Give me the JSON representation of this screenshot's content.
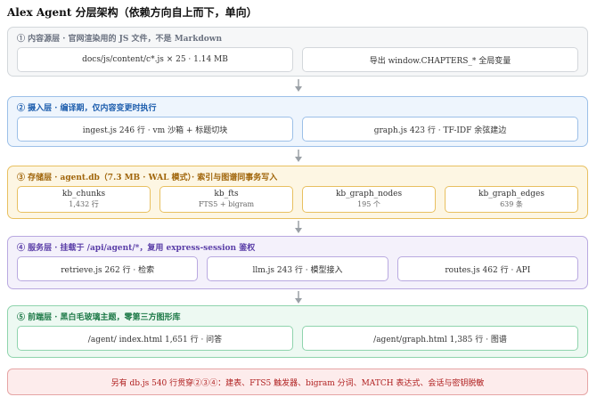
{
  "title": "Alex Agent 分层架构（依赖方向自上而下，单向）",
  "colors": {
    "layer1": {
      "bg": "#f6f7f8",
      "border": "#d3d7db",
      "text": "#6b7280"
    },
    "layer2": {
      "bg": "#eef5fd",
      "border": "#9cc0e8",
      "text": "#1f5fae"
    },
    "layer3": {
      "bg": "#fdf6e3",
      "border": "#e8c060",
      "text": "#a0650a"
    },
    "layer4": {
      "bg": "#f4f1fb",
      "border": "#b9a9e0",
      "text": "#5b3fa8"
    },
    "layer5": {
      "bg": "#edf9f2",
      "border": "#8fd4ad",
      "text": "#1e7a48"
    },
    "note": {
      "bg": "#fdecec",
      "border": "#e6a5a5",
      "text": "#b02020"
    },
    "arrow": "#9aa0a6"
  },
  "layers": [
    {
      "title": "① 内容源层 · 官网渲染用的 JS 文件，不是 Markdown",
      "cells": [
        {
          "text": "docs/js/content/c*.js × 25 · 1.14 MB"
        },
        {
          "text": "导出 window.CHAPTERS_* 全局变量"
        }
      ]
    },
    {
      "title": "② 摄入层 · 编译期，仅内容变更时执行",
      "cells": [
        {
          "text": "ingest.js 246 行 · vm 沙箱 + 标题切块"
        },
        {
          "text": "graph.js 423 行 · TF-IDF 余弦建边"
        }
      ]
    },
    {
      "title": "③ 存储层 · agent.db（7.3 MB · WAL 模式）· 索引与图谱同事务写入",
      "cells": [
        {
          "text": "kb_chunks",
          "sub": "1,432 行"
        },
        {
          "text": "kb_fts",
          "sub": "FTS5 + bigram"
        },
        {
          "text": "kb_graph_nodes",
          "sub": "195 个"
        },
        {
          "text": "kb_graph_edges",
          "sub": "639 条"
        }
      ]
    },
    {
      "title": "④ 服务层 · 挂载于 /api/agent/*，复用 express-session 鉴权",
      "cells": [
        {
          "text": "retrieve.js 262 行 · 检索"
        },
        {
          "text": "llm.js 243 行 · 模型接入"
        },
        {
          "text": "routes.js 462 行 · API"
        }
      ]
    },
    {
      "title": "⑤ 前端层 · 黑白毛玻璃主题，零第三方图形库",
      "cells": [
        {
          "text": "/agent/ index.html 1,651 行 · 问答"
        },
        {
          "text": "/agent/graph.html 1,385 行 · 图谱"
        }
      ]
    }
  ],
  "note": "另有 db.js 540 行贯穿②③④：建表、FTS5 触发器、bigram 分词、MATCH 表达式、会话与密钥脱敏"
}
